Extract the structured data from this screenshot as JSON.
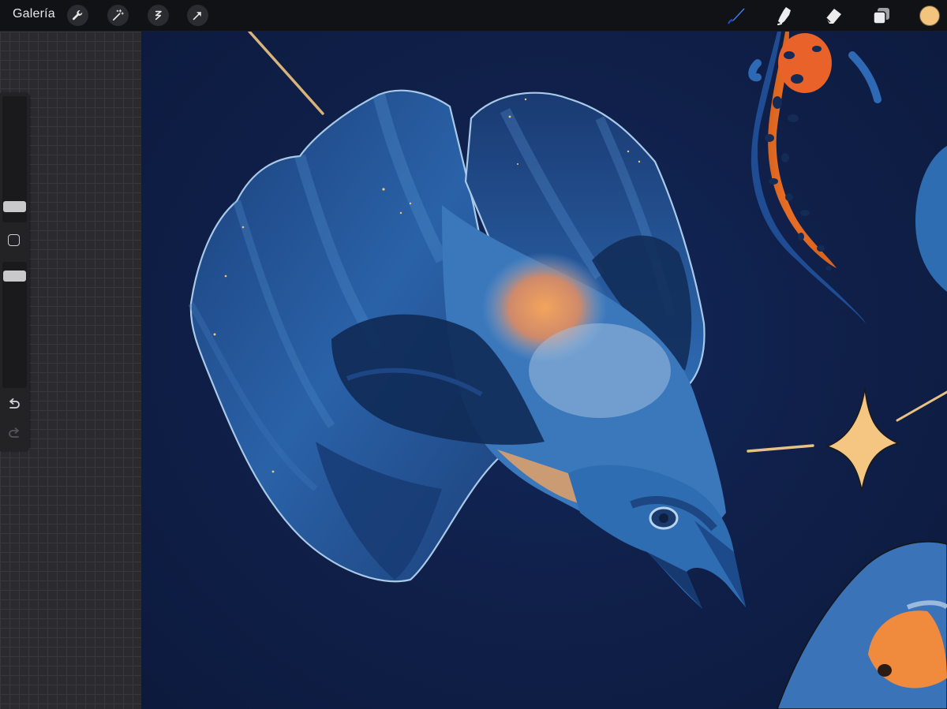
{
  "topbar": {
    "gallery_label": "Galería",
    "left_tools": [
      {
        "icon": "wrench-icon",
        "name": "actions"
      },
      {
        "icon": "magic-wand-icon",
        "name": "adjustments"
      },
      {
        "icon": "selection-s-icon",
        "name": "selection"
      },
      {
        "icon": "arrow-cursor-icon",
        "name": "transform"
      }
    ],
    "right_tools": [
      {
        "icon": "brush-icon",
        "name": "paint",
        "active": true
      },
      {
        "icon": "smudge-icon",
        "name": "smudge"
      },
      {
        "icon": "eraser-icon",
        "name": "eraser"
      },
      {
        "icon": "layers-icon",
        "name": "layers"
      }
    ],
    "current_color": "#f2c47d"
  },
  "sidebar": {
    "brush_size_slider": {
      "icon": "slider-thumb"
    },
    "modify_button": {
      "icon": "square-icon"
    },
    "opacity_slider": {
      "icon": "slider-thumb"
    },
    "undo": {
      "icon": "undo-arrow-icon"
    },
    "redo": {
      "icon": "redo-arrow-icon"
    }
  },
  "colors": {
    "canvas_background": "#0f1e42",
    "toolbar_background": "#111216",
    "accent_brush": "#3b82f6",
    "gold": "#f2c47d",
    "bird_blue": "#2f6db3",
    "bird_orange": "#f0a561"
  }
}
